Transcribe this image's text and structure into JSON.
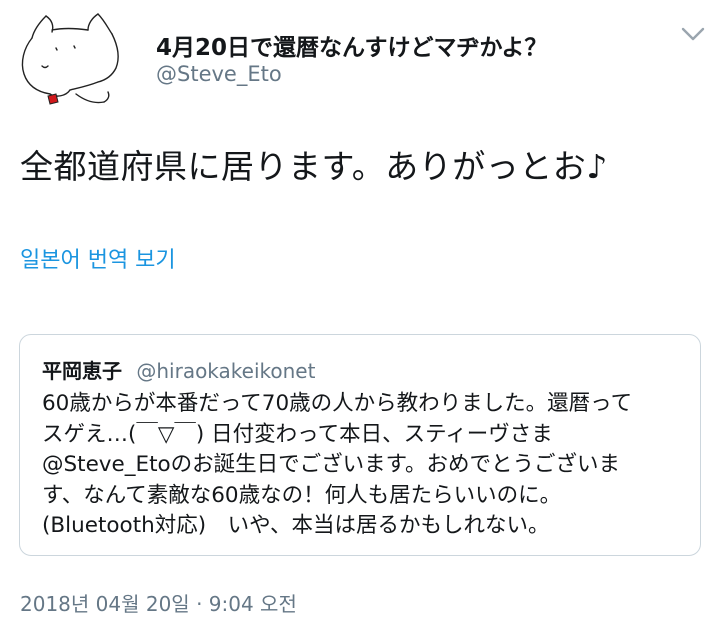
{
  "tweet": {
    "author": {
      "display_name": "4月20日で還暦なんすけどマヂかよ？",
      "handle": "@Steve_Eto",
      "avatar_icon": "dog-drawing-avatar"
    },
    "menu_icon": "chevron-down-icon",
    "text": "全都道府県に居ります。ありがっとお♪",
    "translate_label": "일본어 번역 보기",
    "quoted_tweet": {
      "display_name": "平岡恵子",
      "handle": "@hirаokakeikonet",
      "lines": [
        "60歳からが本番だって70歳の人から教わりました。還暦って",
        "スゲえ…(￣▽￣) 日付変わって本日、スティーヴさま",
        "@Steve_Etoのお誕生日でございます。おめでとうございま",
        "す、なんて素敵な60歳なの！何人も居たらいいのに。",
        "(Bluetooth対応)　いや、本当は居るかもしれない。"
      ]
    },
    "timestamp": "2018년 04월 20일 · 9:04 오전"
  },
  "colors": {
    "text": "#14171a",
    "secondary": "#657786",
    "link": "#1b95e0",
    "border": "#ccd6dd",
    "avatar_accent": "#d0191c"
  }
}
